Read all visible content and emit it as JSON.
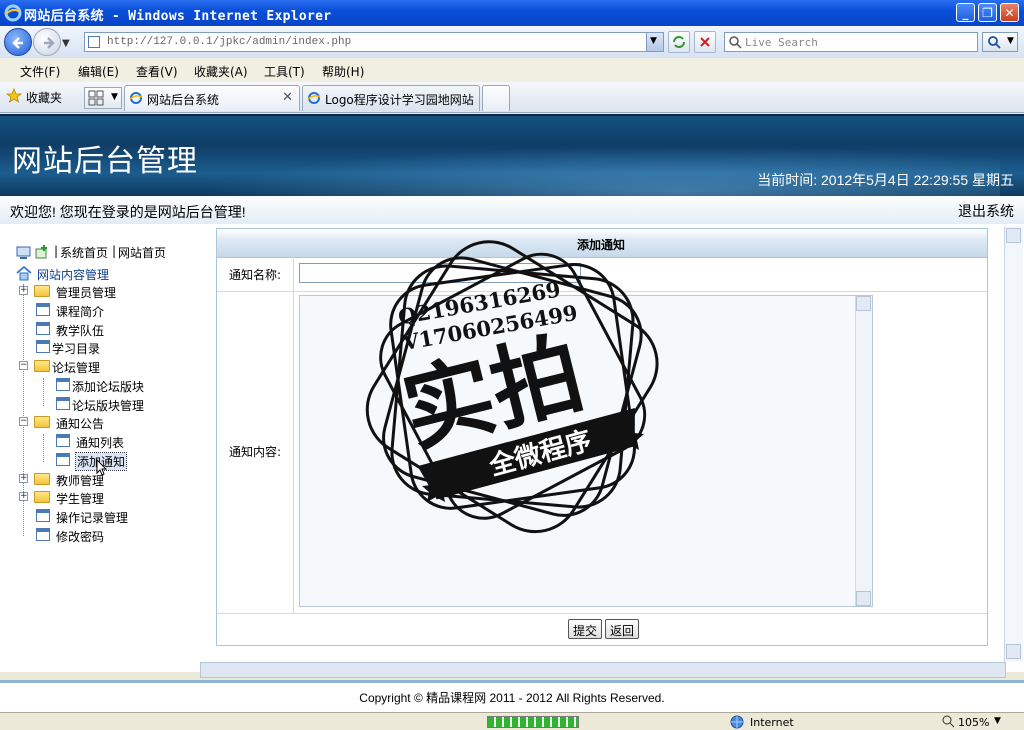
{
  "browser": {
    "window_title": "网站后台系统 - Windows Internet Explorer",
    "url": "http://127.0.0.1/jpkc/admin/index.php",
    "search_placeholder": "Live Search",
    "menu": [
      "文件(F)",
      "编辑(E)",
      "查看(V)",
      "收藏夹(A)",
      "工具(T)",
      "帮助(H)"
    ],
    "favorites_label": "收藏夹",
    "tabs": [
      {
        "label": "网站后台系统",
        "active": true
      },
      {
        "label": "Logo程序设计学习园地网站",
        "active": false
      }
    ],
    "status_zone": "Internet",
    "zoom": "105%"
  },
  "header": {
    "site_title": "网站后台管理",
    "time_text": "当前时间: 2012年5月4日 22:29:55 星期五"
  },
  "welcome": {
    "text": "欢迎您! 您现在登录的是网站后台管理!",
    "logout": "退出系统"
  },
  "sidebar": {
    "top_links": [
      "系统首页",
      "网站首页"
    ],
    "root": "网站内容管理",
    "items": [
      {
        "label": "管理员管理",
        "type": "folder",
        "expander": true,
        "level": 1
      },
      {
        "label": "课程简介",
        "type": "page",
        "level": 1
      },
      {
        "label": "教学队伍",
        "type": "page",
        "level": 1
      },
      {
        "label": "学习目录",
        "type": "page",
        "level": 1
      },
      {
        "label": "论坛管理",
        "type": "folder-open",
        "expander": true,
        "level": 1
      },
      {
        "label": "添加论坛版块",
        "type": "page",
        "level": 2
      },
      {
        "label": "论坛版块管理",
        "type": "page",
        "level": 2
      },
      {
        "label": "通知公告",
        "type": "folder-open",
        "expander": true,
        "level": 1
      },
      {
        "label": "通知列表",
        "type": "page",
        "level": 2
      },
      {
        "label": "添加通知",
        "type": "page",
        "level": 2,
        "selected": true
      },
      {
        "label": "教师管理",
        "type": "folder",
        "expander": true,
        "level": 1
      },
      {
        "label": "学生管理",
        "type": "folder",
        "expander": true,
        "level": 1
      },
      {
        "label": "操作记录管理",
        "type": "page",
        "level": 1
      },
      {
        "label": "修改密码",
        "type": "page",
        "level": 1
      }
    ]
  },
  "form": {
    "title": "添加通知",
    "name_label": "通知名称:",
    "content_label": "通知内容:",
    "submit": "提交",
    "back": "返回"
  },
  "footer": {
    "copyright": "Copyright © 精品课程网 2011 - 2012 All Rights Reserved."
  },
  "watermark": {
    "line1": "Q2196316269",
    "line2": "V17060256499",
    "main": "实拍",
    "banner": "全微程序"
  }
}
